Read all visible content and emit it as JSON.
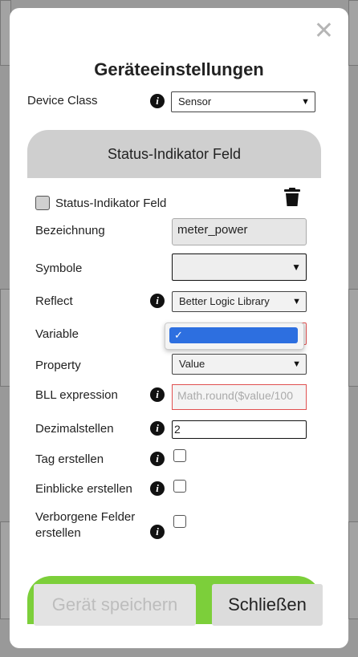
{
  "modal": {
    "title": "Geräteeinstellungen",
    "device_class_label": "Device Class",
    "device_class_value": "Sensor",
    "panel_title": "Status-Indikator Feld"
  },
  "form": {
    "status_checkbox_label": "Status-Indikator Feld",
    "bezeichnung_label": "Bezeichnung",
    "bezeichnung_value": "meter_power",
    "symbole_label": "Symbole",
    "reflect_label": "Reflect",
    "reflect_value": "Better Logic Library",
    "variable_label": "Variable",
    "variable_dropdown_check": "✓",
    "property_label": "Property",
    "property_value": "Value",
    "bll_label": "BLL expression",
    "bll_placeholder": "Math.round($value/100",
    "dezimal_label": "Dezimalstellen",
    "dezimal_value": "2",
    "tag_label": "Tag erstellen",
    "einblicke_label": "Einblicke erstellen",
    "verborgen_label_line1": "Verborgene Felder",
    "verborgen_label_line2": "erstellen"
  },
  "footer": {
    "save_label": "Gerät speichern",
    "close_label": "Schließen"
  },
  "colors": {
    "accent_blue": "#2d6fe0",
    "green_bar": "#7ccf3a",
    "error_red": "#e05050"
  },
  "icons": [
    "close-icon",
    "info-icon",
    "trash-icon",
    "chevron-down-icon",
    "checkmark-icon"
  ]
}
